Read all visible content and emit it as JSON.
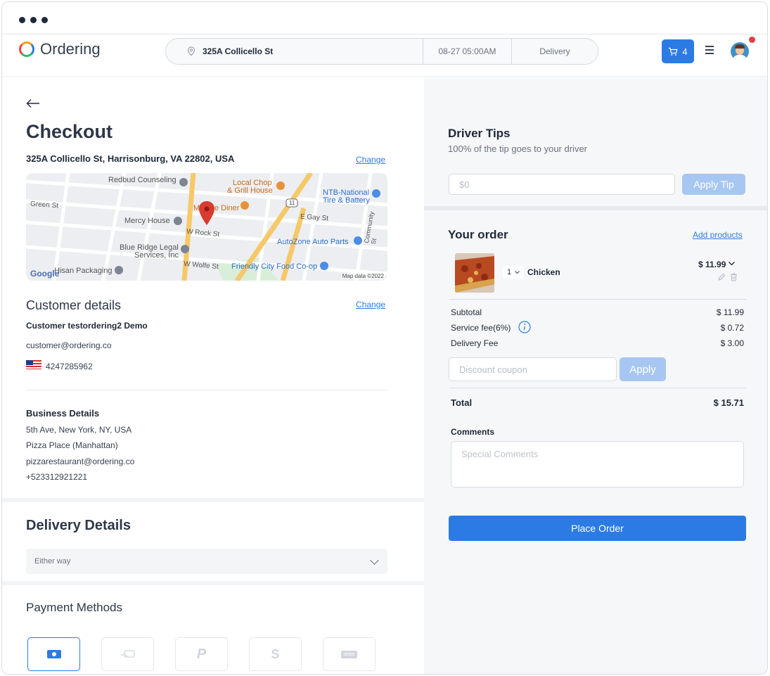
{
  "header": {
    "logo_text": "Ordering",
    "address": "325A Collicello St",
    "datetime": "08-27 05:00AM",
    "order_type": "Delivery",
    "cart_count": "4"
  },
  "checkout": {
    "title": "Checkout",
    "address_full": "325A Collicello St, Harrisonburg, VA 22802, USA",
    "change_label": "Change"
  },
  "map": {
    "labels": {
      "redbud": "Redbud Counseling",
      "local_chop": "Local Chop",
      "grill_house": "& Grill House",
      "ntb": "NTB-National",
      "tire": "Tire & Battery",
      "green_st": "Green St",
      "mercy": "Mercy House",
      "diner": "M",
      "diner2": "e Diner",
      "route": "11",
      "e_gay": "E Gay St",
      "community": "Community St",
      "w_rock": "W Rock St",
      "autozone": "AutoZone Auto Parts",
      "blue_ridge": "Blue Ridge Legal",
      "services": "Services, Inc",
      "w_wolfe": "W Wolfe St",
      "friendly": "Friendly City Food Co-op",
      "google": "Google",
      "hisan": "Hisan Packaging",
      "map_data": "Map data ©2022"
    }
  },
  "customer": {
    "section_title": "Customer details",
    "change_label": "Change",
    "name": "Customer testordering2 Demo",
    "email": "customer@ordering.co",
    "phone": "4247285962"
  },
  "business": {
    "title": "Business Details",
    "address": "5th Ave, New York, NY, USA",
    "name": "Pizza Place (Manhattan)",
    "email": "pizzarestaurant@ordering.co",
    "phone": "+523312921221"
  },
  "delivery": {
    "title": "Delivery Details",
    "option": "Either way"
  },
  "payment": {
    "title": "Payment Methods",
    "methods": [
      "cash-icon",
      "card-delivery-icon",
      "paypal-icon",
      "stripe-s-icon",
      "stripe-icon"
    ],
    "stripe_text": "stripe",
    "paypal_text": "P",
    "s_text": "S"
  },
  "tips": {
    "title": "Driver Tips",
    "subtitle": "100% of the tip goes to your driver",
    "placeholder": "$0",
    "apply_label": "Apply Tip"
  },
  "order": {
    "title": "Your order",
    "add_products_label": "Add products",
    "item": {
      "qty": "1",
      "name": "Chicken",
      "price": "$ 11.99"
    },
    "subtotal_label": "Subtotal",
    "subtotal": "$ 11.99",
    "service_fee_label": "Service fee(6%)",
    "service_fee": "$ 0.72",
    "delivery_fee_label": "Delivery Fee",
    "delivery_fee": "$ 3.00",
    "coupon_placeholder": "Discount coupon",
    "apply_label": "Apply",
    "total_label": "Total",
    "total": "$ 15.71",
    "comments_label": "Comments",
    "comments_placeholder": "Special Comments",
    "place_order_label": "Place Order"
  },
  "colors": {
    "primary": "#2c7be5",
    "primary_soft": "#a7c7f2",
    "notification": "#e53e3e"
  }
}
